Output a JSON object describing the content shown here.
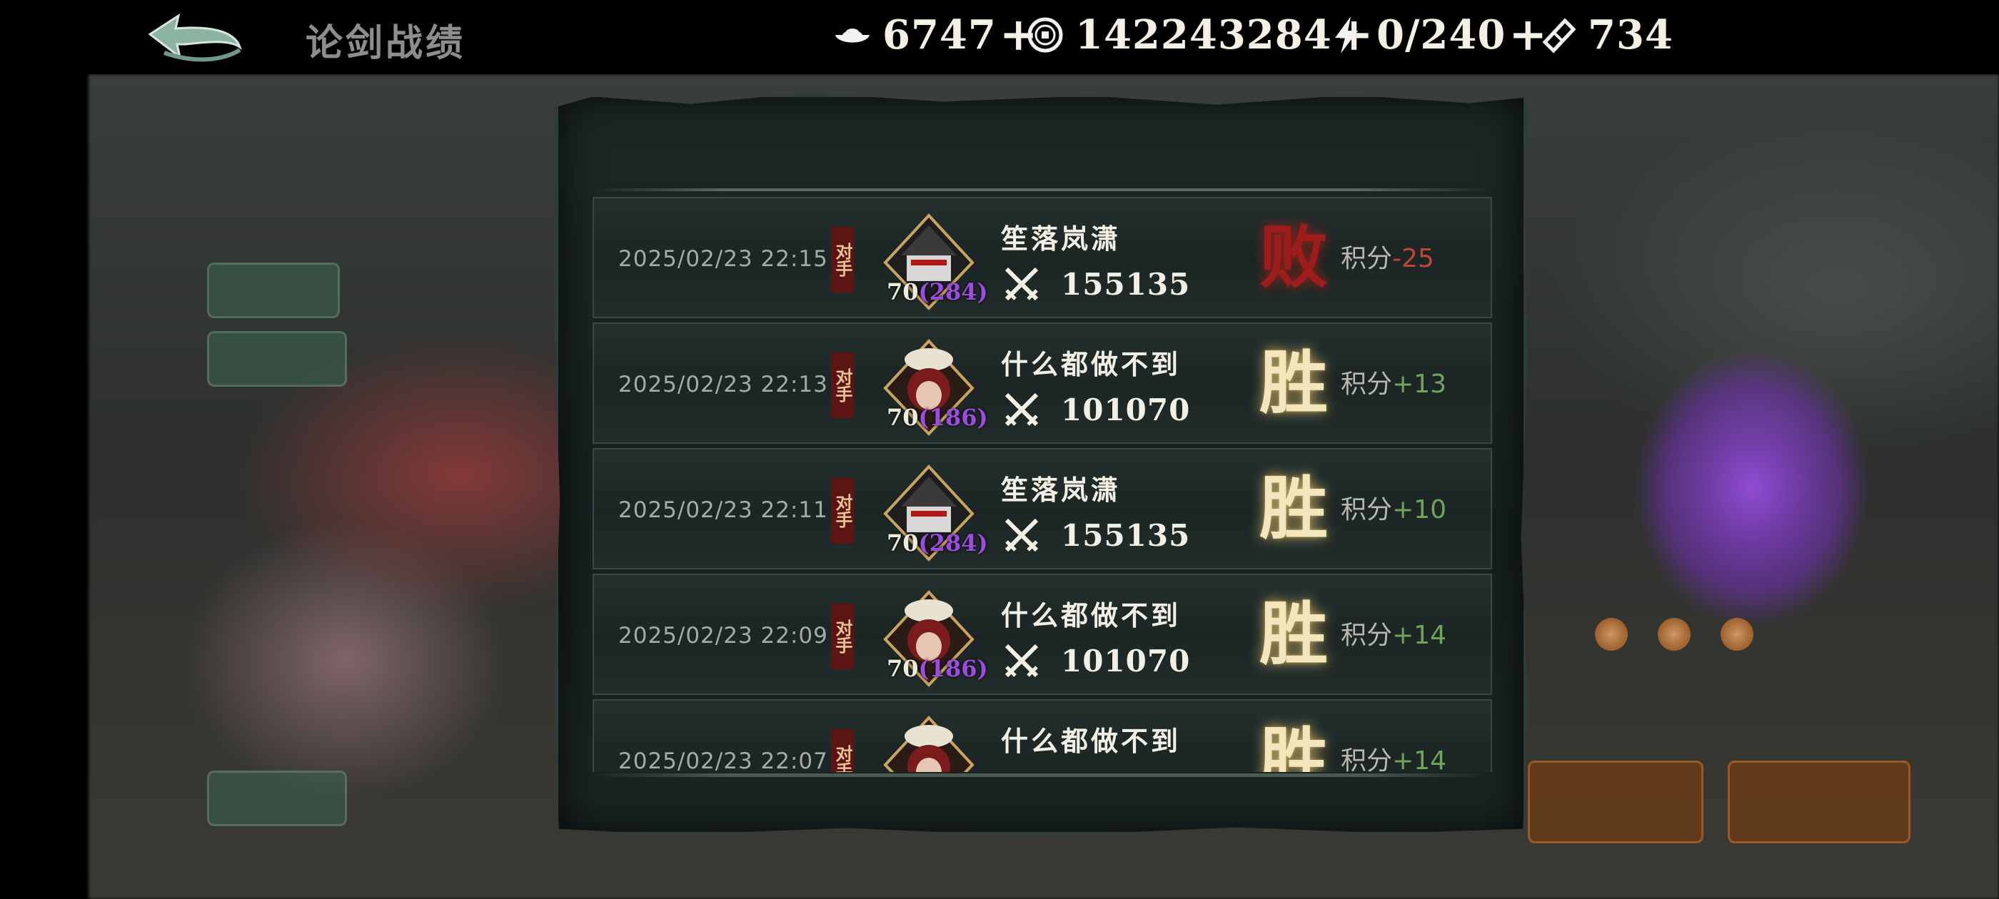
{
  "header": {
    "title": "论剑战绩",
    "resources": [
      {
        "icon": "silver-ingot-icon",
        "value": "6747"
      },
      {
        "icon": "coin-icon",
        "value": "142243284"
      },
      {
        "icon": "stamina-bolt-icon",
        "value": "0/240"
      },
      {
        "icon": "ticket-icon",
        "value": "734"
      }
    ]
  },
  "records": [
    {
      "time": "2025/02/23 22:15",
      "tag": "对手",
      "level": "70",
      "inner_level": "(284)",
      "opponent": "笙落岚潇",
      "power": "155135",
      "result": "败",
      "score_label": "积分",
      "score": "-25"
    },
    {
      "time": "2025/02/23 22:13",
      "tag": "对手",
      "level": "70",
      "inner_level": "(186)",
      "opponent": "什么都做不到",
      "power": "101070",
      "result": "胜",
      "score_label": "积分",
      "score": "+13"
    },
    {
      "time": "2025/02/23 22:11",
      "tag": "对手",
      "level": "70",
      "inner_level": "(284)",
      "opponent": "笙落岚潇",
      "power": "155135",
      "result": "胜",
      "score_label": "积分",
      "score": "+10"
    },
    {
      "time": "2025/02/23 22:09",
      "tag": "对手",
      "level": "70",
      "inner_level": "(186)",
      "opponent": "什么都做不到",
      "power": "101070",
      "result": "胜",
      "score_label": "积分",
      "score": "+14"
    },
    {
      "time": "2025/02/23 22:07",
      "tag": "对手",
      "level": "",
      "inner_level": "",
      "opponent": "什么都做不到",
      "power": "",
      "result": "胜",
      "score_label": "积分",
      "score": "+14"
    }
  ],
  "colors": {
    "win": "#f3e6bd",
    "loss": "#9c1d1a",
    "score_positive": "#6fa55a",
    "score_negative": "#c04436",
    "inner_level": "#9a4de0"
  }
}
